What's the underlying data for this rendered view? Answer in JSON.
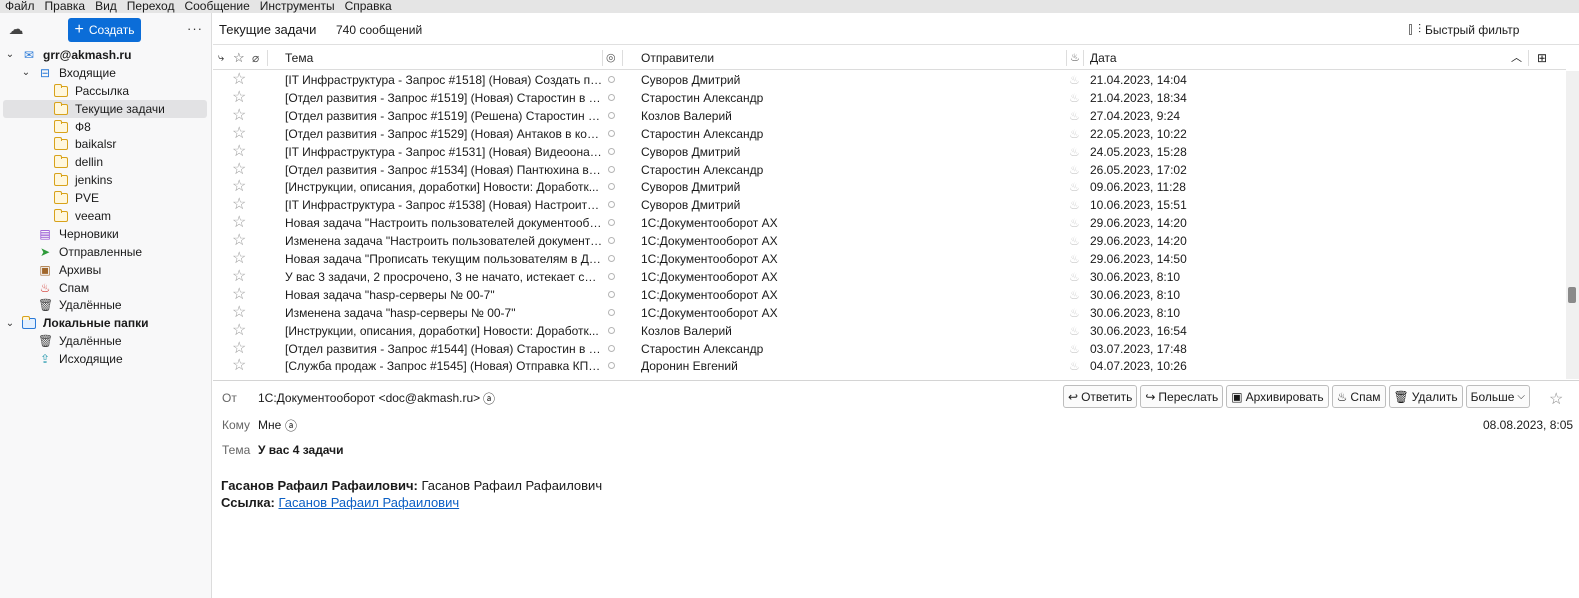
{
  "menu": [
    "Файл",
    "Правка",
    "Вид",
    "Переход",
    "Сообщение",
    "Инструменты",
    "Справка"
  ],
  "sidebar": {
    "create_label": "Создать",
    "tree": [
      {
        "label": "grr@akmash.ru",
        "bold": true,
        "level": 0,
        "twisty": "v",
        "icon": "mail-account-icon"
      },
      {
        "label": "Входящие",
        "level": 1,
        "twisty": "v",
        "icon": "inbox-icon"
      },
      {
        "label": "Рассылка",
        "level": 2,
        "icon": "folder-icon"
      },
      {
        "label": "Текущие задачи",
        "level": 2,
        "icon": "folder-icon",
        "selected": true
      },
      {
        "label": "Ф8",
        "level": 2,
        "icon": "folder-icon"
      },
      {
        "label": "baikalsr",
        "level": 2,
        "icon": "folder-icon"
      },
      {
        "label": "dellin",
        "level": 2,
        "icon": "folder-icon"
      },
      {
        "label": "jenkins",
        "level": 2,
        "icon": "folder-icon"
      },
      {
        "label": "PVE",
        "level": 2,
        "icon": "folder-icon"
      },
      {
        "label": "veeam",
        "level": 2,
        "icon": "folder-icon"
      },
      {
        "label": "Черновики",
        "level": 1,
        "icon": "drafts-icon"
      },
      {
        "label": "Отправленные",
        "level": 1,
        "icon": "sent-icon"
      },
      {
        "label": "Архивы",
        "level": 1,
        "icon": "archive-icon"
      },
      {
        "label": "Спам",
        "level": 1,
        "icon": "spam-icon"
      },
      {
        "label": "Удалённые",
        "level": 1,
        "icon": "trash-icon"
      },
      {
        "label": "Локальные папки",
        "bold": true,
        "level": 0,
        "twisty": "v",
        "icon": "local-folders-icon"
      },
      {
        "label": "Удалённые",
        "level": 1,
        "icon": "trash-icon"
      },
      {
        "label": "Исходящие",
        "level": 1,
        "icon": "outbox-icon"
      }
    ]
  },
  "header": {
    "folder_title": "Текущие задачи",
    "message_count": "740 сообщений",
    "quick_filter": "Быстрый фильтр"
  },
  "columns": {
    "subject": "Тема",
    "senders": "Отправители",
    "date": "Дата"
  },
  "messages": [
    {
      "subject": "[IT Инфраструктура - Запрос #1518] (Новая) Создать по...",
      "sender": "Суворов Дмитрий",
      "date": "21.04.2023, 14:04"
    },
    {
      "subject": "[Отдел развития - Запрос #1519] (Новая) Старостин в ко...",
      "sender": "Старостин Александр",
      "date": "21.04.2023, 18:34"
    },
    {
      "subject": "[Отдел развития - Запрос #1519] (Решена) Старостин в к...",
      "sender": "Козлов Валерий",
      "date": "27.04.2023, 9:24"
    },
    {
      "subject": "[Отдел развития - Запрос #1529] (Новая) Антаков в кома...",
      "sender": "Старостин Александр",
      "date": "22.05.2023, 10:22"
    },
    {
      "subject": "[IT Инфраструктура - Запрос #1531] (Новая) Видеоонаб...",
      "sender": "Суворов Дмитрий",
      "date": "24.05.2023, 15:28"
    },
    {
      "subject": "[Отдел развития - Запрос #1534] (Новая) Пантюхина в о...",
      "sender": "Старостин Александр",
      "date": "26.05.2023, 17:02"
    },
    {
      "subject": "[Инструкции, описания, доработки] Новости: Доработк...",
      "sender": "Суворов Дмитрий",
      "date": "09.06.2023, 11:28"
    },
    {
      "subject": "[IT Инфраструктура - Запрос #1538] (Новая) Настроить ...",
      "sender": "Суворов Дмитрий",
      "date": "10.06.2023, 15:51"
    },
    {
      "subject": "Новая задача \"Настроить пользователей документообо...",
      "sender": "1С:Документооборот АХ",
      "date": "29.06.2023, 14:20"
    },
    {
      "subject": "Изменена задача \"Настроить пользователей документо...",
      "sender": "1С:Документооборот АХ",
      "date": "29.06.2023, 14:20"
    },
    {
      "subject": "Новая задача \"Прописать текущим пользователям в ДО...",
      "sender": "1С:Документооборот АХ",
      "date": "29.06.2023, 14:50"
    },
    {
      "subject": "У вас 3 задачи, 2 просрочено, 3 не начато, истекает срок...",
      "sender": "1С:Документооборот АХ",
      "date": "30.06.2023, 8:10"
    },
    {
      "subject": "Новая задача \"hasp-серверы № 00-7\"",
      "sender": "1С:Документооборот АХ",
      "date": "30.06.2023, 8:10"
    },
    {
      "subject": "Изменена задача \"hasp-серверы № 00-7\"",
      "sender": "1С:Документооборот АХ",
      "date": "30.06.2023, 8:10"
    },
    {
      "subject": "[Инструкции, описания, доработки] Новости: Доработк...",
      "sender": "Козлов Валерий",
      "date": "30.06.2023, 16:54"
    },
    {
      "subject": "[Отдел развития - Запрос #1544] (Новая) Старостин в ко...",
      "sender": "Старостин Александр",
      "date": "03.07.2023, 17:48"
    },
    {
      "subject": "[Служба продаж - Запрос #1545] (Новая) Отправка КП и...",
      "sender": "Доронин Евгений",
      "date": "04.07.2023, 10:26"
    }
  ],
  "message_header": {
    "from_label": "От",
    "from_value": "1С:Документооборот <doc@akmash.ru>",
    "to_label": "Кому",
    "to_value": "Мне",
    "subject_label": "Тема",
    "subject_value": "У вас 4 задачи",
    "date": "08.08.2023, 8:05",
    "actions": {
      "reply": "Ответить",
      "forward": "Переслать",
      "archive": "Архивировать",
      "spam": "Спам",
      "delete": "Удалить",
      "more": "Больше"
    }
  },
  "body": {
    "line1_label": "Гасанов Рафаил Рафаилович:",
    "line1_value": "Гасанов Рафаил Рафаилович",
    "line2_label": "Ссылка:",
    "line2_link": "Гасанов Рафаил Рафаилович"
  },
  "colors": {
    "accent": "#0b6dd8",
    "folder": "#d8a21a",
    "link": "#0b5fc4"
  }
}
